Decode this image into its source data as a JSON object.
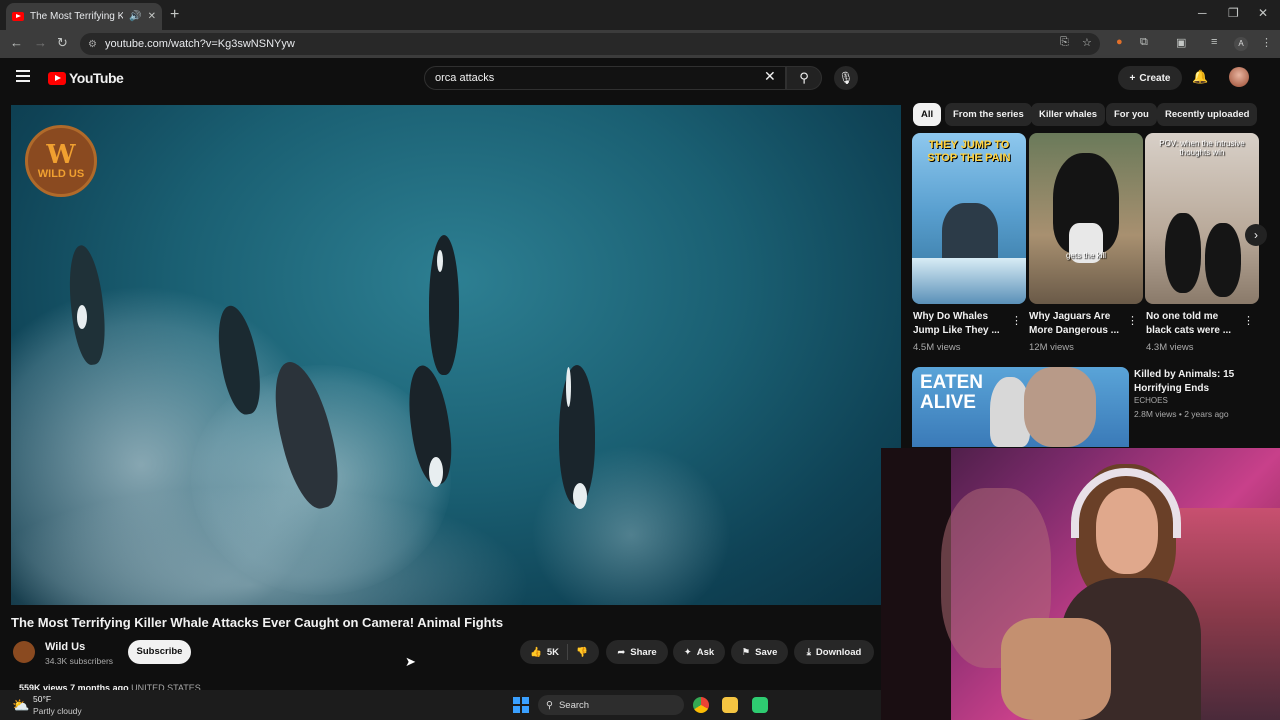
{
  "browser": {
    "tab_title": "The Most Terrifying Killer W",
    "url": "youtube.com/watch?v=Kg3swNSNYyw",
    "profile_initial": "A"
  },
  "header": {
    "logo_text": "YouTube",
    "search_query": "orca attacks",
    "create_label": "Create"
  },
  "player": {
    "channel_badge_top": "W",
    "channel_badge_bottom": "WILD US"
  },
  "video": {
    "title": "The Most Terrifying Killer Whale Attacks Ever Caught on Camera! Animal Fights",
    "channel": "Wild Us",
    "subscribers": "34.3K subscribers",
    "subscribe_label": "Subscribe",
    "likes": "5K",
    "share_label": "Share",
    "ask_label": "Ask",
    "save_label": "Save",
    "download_label": "Download",
    "views": "559K views",
    "age": "7 months ago",
    "location": "UNITED STATES"
  },
  "chips": [
    "All",
    "From the series",
    "Killer whales",
    "For you",
    "Recently uploaded"
  ],
  "shorts": [
    {
      "caption_line1": "Why Do Whales",
      "caption_line2": "Jump Like They ...",
      "views": "4.5M views",
      "overlay": "THEY JUMP TO STOP THE PAIN"
    },
    {
      "caption_line1": "Why Jaguars Are",
      "caption_line2": "More Dangerous ...",
      "views": "12M views",
      "overlay": "gets the kill"
    },
    {
      "caption_line1": "No one told me",
      "caption_line2": "black cats were ...",
      "views": "4.3M views",
      "overlay": "POV: when the intrusive thoughts win"
    }
  ],
  "recommended": {
    "title": "Killed by Animals: 15 Horrifying Ends",
    "channel": "ECHOES",
    "meta": "2.8M views • 2 years ago",
    "thumb_text_1": "EATEN",
    "thumb_text_2": "ALIVE"
  },
  "taskbar": {
    "temp": "50°F",
    "weather": "Partly cloudy",
    "search_label": "Search"
  },
  "icons": {
    "brand_red": "#ff0000",
    "accent_blue": "#3ea6ff"
  }
}
